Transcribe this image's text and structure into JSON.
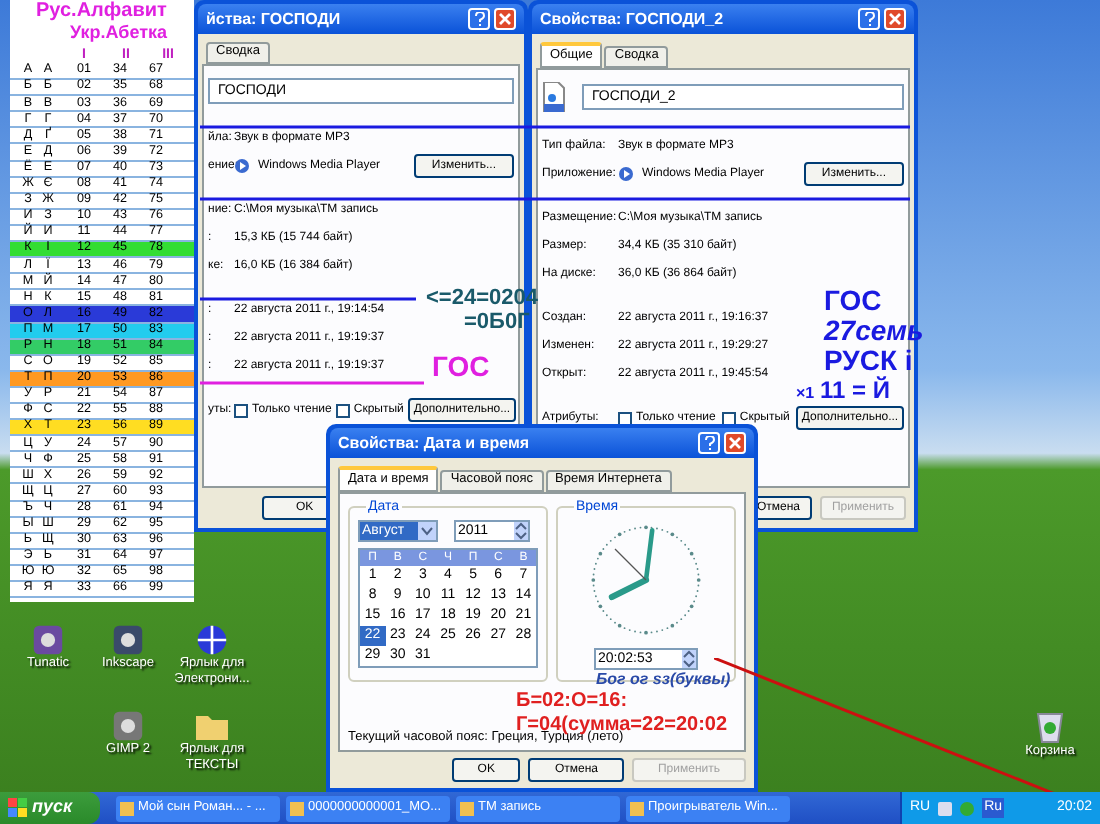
{
  "alphabet_table": {
    "title_ru": "Рус.Алфавит",
    "title_uk": "Укр.Абетка",
    "columns": [
      "I",
      "II",
      "III"
    ],
    "rows": [
      {
        "ru": "А",
        "uk": "А",
        "values": [
          "01",
          "34",
          "67"
        ]
      },
      {
        "ru": "Б",
        "uk": "Б",
        "values": [
          "02",
          "35",
          "68"
        ]
      },
      {
        "ru": "В",
        "uk": "В",
        "values": [
          "03",
          "36",
          "69"
        ]
      },
      {
        "ru": "Г",
        "uk": "Г",
        "values": [
          "04",
          "37",
          "70"
        ]
      },
      {
        "ru": "Д",
        "uk": "Ґ",
        "values": [
          "05",
          "38",
          "71"
        ]
      },
      {
        "ru": "Е",
        "uk": "Д",
        "values": [
          "06",
          "39",
          "72"
        ]
      },
      {
        "ru": "Ё",
        "uk": "Е",
        "values": [
          "07",
          "40",
          "73"
        ]
      },
      {
        "ru": "Ж",
        "uk": "Є",
        "values": [
          "08",
          "41",
          "74"
        ]
      },
      {
        "ru": "З",
        "uk": "Ж",
        "values": [
          "09",
          "42",
          "75"
        ]
      },
      {
        "ru": "И",
        "uk": "З",
        "values": [
          "10",
          "43",
          "76"
        ]
      },
      {
        "ru": "Й",
        "uk": "И",
        "values": [
          "11",
          "44",
          "77"
        ]
      },
      {
        "ru": "К",
        "uk": "І",
        "values": [
          "12",
          "45",
          "78"
        ],
        "color": "#33dd33"
      },
      {
        "ru": "Л",
        "uk": "Ї",
        "values": [
          "13",
          "46",
          "79"
        ]
      },
      {
        "ru": "М",
        "uk": "Й",
        "values": [
          "14",
          "47",
          "80"
        ]
      },
      {
        "ru": "Н",
        "uk": "К",
        "values": [
          "15",
          "48",
          "81"
        ]
      },
      {
        "ru": "О",
        "uk": "Л",
        "values": [
          "16",
          "49",
          "82"
        ],
        "color": "#2a3ad8"
      },
      {
        "ru": "П",
        "uk": "М",
        "values": [
          "17",
          "50",
          "83"
        ],
        "color": "#22ccee"
      },
      {
        "ru": "Р",
        "uk": "Н",
        "values": [
          "18",
          "51",
          "84"
        ],
        "color": "#33cc66"
      },
      {
        "ru": "С",
        "uk": "О",
        "values": [
          "19",
          "52",
          "85"
        ]
      },
      {
        "ru": "Т",
        "uk": "П",
        "values": [
          "20",
          "53",
          "86"
        ],
        "color": "#ff9922"
      },
      {
        "ru": "У",
        "uk": "Р",
        "values": [
          "21",
          "54",
          "87"
        ]
      },
      {
        "ru": "Ф",
        "uk": "С",
        "values": [
          "22",
          "55",
          "88"
        ]
      },
      {
        "ru": "Х",
        "uk": "Т",
        "values": [
          "23",
          "56",
          "89"
        ],
        "color": "#ffdd22"
      },
      {
        "ru": "Ц",
        "uk": "У",
        "values": [
          "24",
          "57",
          "90"
        ]
      },
      {
        "ru": "Ч",
        "uk": "Ф",
        "values": [
          "25",
          "58",
          "91"
        ]
      },
      {
        "ru": "Ш",
        "uk": "Х",
        "values": [
          "26",
          "59",
          "92"
        ]
      },
      {
        "ru": "Щ",
        "uk": "Ц",
        "values": [
          "27",
          "60",
          "93"
        ]
      },
      {
        "ru": "Ъ",
        "uk": "Ч",
        "values": [
          "28",
          "61",
          "94"
        ]
      },
      {
        "ru": "Ы",
        "uk": "Ш",
        "values": [
          "29",
          "62",
          "95"
        ]
      },
      {
        "ru": "Ь",
        "uk": "Щ",
        "values": [
          "30",
          "63",
          "96"
        ]
      },
      {
        "ru": "Э",
        "uk": "Ь",
        "values": [
          "31",
          "64",
          "97"
        ]
      },
      {
        "ru": "Ю",
        "uk": "Ю",
        "values": [
          "32",
          "65",
          "98"
        ]
      },
      {
        "ru": "Я",
        "uk": "Я",
        "values": [
          "33",
          "66",
          "99"
        ]
      }
    ]
  },
  "desktop_icons": [
    {
      "label": "Tunatic",
      "kind": "app"
    },
    {
      "label": "Inkscape",
      "kind": "app"
    },
    {
      "label": "Ярлык для Электрони...",
      "kind": "shortcut"
    },
    {
      "label": "GIMP 2",
      "kind": "app"
    },
    {
      "label": "Ярлык для ТЕКСТЫ",
      "kind": "folder"
    },
    {
      "label": "Корзина",
      "kind": "trash"
    }
  ],
  "windows": [
    {
      "title": "йства: ГОСПОДИ",
      "tabs": [
        {
          "label": "Сводка",
          "selected": false
        }
      ],
      "file_name": "ГОСПОДИ",
      "fields": [
        {
          "kind": "text",
          "label": "йла:",
          "value": "Звук в формате MP3"
        },
        {
          "kind": "app",
          "label": "ение:",
          "value": "Windows Media Player",
          "button": "Изменить..."
        },
        {
          "kind": "text",
          "label": "ние:",
          "value": "C:\\Моя музыка\\TM запись"
        },
        {
          "kind": "text",
          "label": ":",
          "value": "15,3 КБ (15 744 байт)"
        },
        {
          "kind": "text",
          "label": "ке:",
          "value": "16,0 КБ (16 384 байт)"
        },
        {
          "kind": "text",
          "label": ":",
          "value": "22 августа 2011 г., 19:14:54"
        },
        {
          "kind": "text",
          "label": ":",
          "value": "22 августа 2011 г., 19:19:37"
        },
        {
          "kind": "text",
          "label": ":",
          "value": "22 августа 2011 г., 19:19:37"
        },
        {
          "kind": "attributes",
          "label": "уты:",
          "checkboxes": [
            {
              "label": "Только чтение",
              "checked": false
            },
            {
              "label": "Скрытый",
              "checked": false
            }
          ],
          "button": "Дополнительно..."
        }
      ],
      "buttons": [
        {
          "label": "OK",
          "disabled": false
        }
      ]
    },
    {
      "title": "Свойства: ГОСПОДИ_2",
      "tabs": [
        {
          "label": "Общие",
          "selected": true
        },
        {
          "label": "Сводка",
          "selected": false
        }
      ],
      "file_name": "ГОСПОДИ_2",
      "fields": [
        {
          "kind": "text",
          "label": "Тип файла:",
          "value": "Звук в формате MP3"
        },
        {
          "kind": "app",
          "label": "Приложение:",
          "value": "Windows Media Player",
          "button": "Изменить..."
        },
        {
          "kind": "text",
          "label": "Размещение:",
          "value": "C:\\Моя музыка\\TM запись"
        },
        {
          "kind": "text",
          "label": "Размер:",
          "value": "34,4 КБ (35 310 байт)"
        },
        {
          "kind": "text",
          "label": "На диске:",
          "value": "36,0 КБ (36 864 байт)"
        },
        {
          "kind": "text",
          "label": "Создан:",
          "value": "22 августа 2011 г., 19:16:37"
        },
        {
          "kind": "text",
          "label": "Изменен:",
          "value": "22 августа 2011 г., 19:29:27"
        },
        {
          "kind": "text",
          "label": "Открыт:",
          "value": "22 августа 2011 г., 19:45:54"
        },
        {
          "kind": "attributes",
          "label": "Атрибуты:",
          "checkboxes": [
            {
              "label": "Только чтение",
              "checked": false
            },
            {
              "label": "Скрытый",
              "checked": false
            }
          ],
          "button": "Дополнительно..."
        }
      ],
      "buttons": [
        {
          "label": "Отмена",
          "disabled": false
        },
        {
          "label": "Применить",
          "disabled": true
        }
      ]
    }
  ],
  "date_dialog": {
    "title": "Свойства: Дата и время",
    "tabs": [
      {
        "label": "Дата и время",
        "selected": true
      },
      {
        "label": "Часовой пояс",
        "selected": false
      },
      {
        "label": "Время Интернета",
        "selected": false
      }
    ],
    "date_group": {
      "label": "Дата",
      "month": "Август",
      "year": "2011",
      "weekdays": [
        "П",
        "В",
        "С",
        "Ч",
        "П",
        "С",
        "В"
      ],
      "days": [
        {
          "label": "1",
          "selected": false
        },
        {
          "label": "2",
          "selected": false
        },
        {
          "label": "3",
          "selected": false
        },
        {
          "label": "4",
          "selected": false
        },
        {
          "label": "5",
          "selected": false
        },
        {
          "label": "6",
          "selected": false
        },
        {
          "label": "7",
          "selected": false
        },
        {
          "label": "8",
          "selected": false
        },
        {
          "label": "9",
          "selected": false
        },
        {
          "label": "10",
          "selected": false
        },
        {
          "label": "11",
          "selected": false
        },
        {
          "label": "12",
          "selected": false
        },
        {
          "label": "13",
          "selected": false
        },
        {
          "label": "14",
          "selected": false
        },
        {
          "label": "15",
          "selected": false
        },
        {
          "label": "16",
          "selected": false
        },
        {
          "label": "17",
          "selected": false
        },
        {
          "label": "18",
          "selected": false
        },
        {
          "label": "19",
          "selected": false
        },
        {
          "label": "20",
          "selected": false
        },
        {
          "label": "21",
          "selected": false
        },
        {
          "label": "22",
          "selected": true
        },
        {
          "label": "23",
          "selected": false
        },
        {
          "label": "24",
          "selected": false
        },
        {
          "label": "25",
          "selected": false
        },
        {
          "label": "26",
          "selected": false
        },
        {
          "label": "27",
          "selected": false
        },
        {
          "label": "28",
          "selected": false
        },
        {
          "label": "29",
          "selected": false
        },
        {
          "label": "30",
          "selected": false
        },
        {
          "label": "31",
          "selected": false
        }
      ]
    },
    "time_group": {
      "label": "Время",
      "time": "20:02:53"
    },
    "timezone": "Текущий часовой пояс: Греция, Турция (лето)",
    "buttons": [
      {
        "label": "OK",
        "disabled": false
      },
      {
        "label": "Отмена",
        "disabled": false
      },
      {
        "label": "Применить",
        "disabled": true
      }
    ]
  },
  "annotations": [
    {
      "text": "<=24=0204",
      "color": "#1a5a6a"
    },
    {
      "text": "=0Б0Г",
      "color": "#1a5a6a"
    },
    {
      "text": "ГОС",
      "color": "#e020e0"
    },
    {
      "text": "ГОС",
      "color": "#1a1ae0"
    },
    {
      "text": "27семь",
      "color": "#1a1ae0"
    },
    {
      "text": "РУСК і",
      "color": "#1a1ae0"
    },
    {
      "text": "×1",
      "color": "#1a1ae0"
    },
    {
      "text": "11 = Й",
      "color": "#1a1ae0"
    },
    {
      "text": "Бог ог ѕз(буквы)",
      "color": "#2a4aa8"
    },
    {
      "text": "Б=02:O=16:",
      "color": "#e02020"
    },
    {
      "text": "Г=04(сумма=22=20:02",
      "color": "#e02020"
    }
  ],
  "taskbar": {
    "start": "пуск",
    "tasks": [
      "Мой сын Роман... - ...",
      "0000000000001_MO...",
      "TM запись",
      "Проигрыватель Win..."
    ],
    "tray": {
      "language": "RU",
      "keyboard": "Ru",
      "clock": "20:02"
    }
  }
}
